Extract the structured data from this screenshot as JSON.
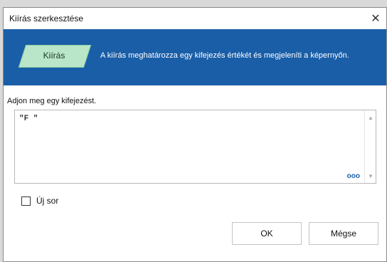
{
  "window": {
    "title": "Kiírás szerkesztése",
    "close_symbol": "✕"
  },
  "banner": {
    "shape_label": "Kiírás",
    "description": "A kiírás meghatározza egy kifejezés értékét és megjeleníti a képernyőn.",
    "color": "#1a5ea8",
    "shape_color": "#b9e6c8"
  },
  "editor": {
    "prompt": "Adjon meg egy kifejezést.",
    "value": "\"F \"",
    "more_icon": "ooo"
  },
  "options": {
    "new_line_label": "Új sor",
    "new_line_checked": false
  },
  "buttons": {
    "ok": "OK",
    "cancel": "Mégse"
  }
}
